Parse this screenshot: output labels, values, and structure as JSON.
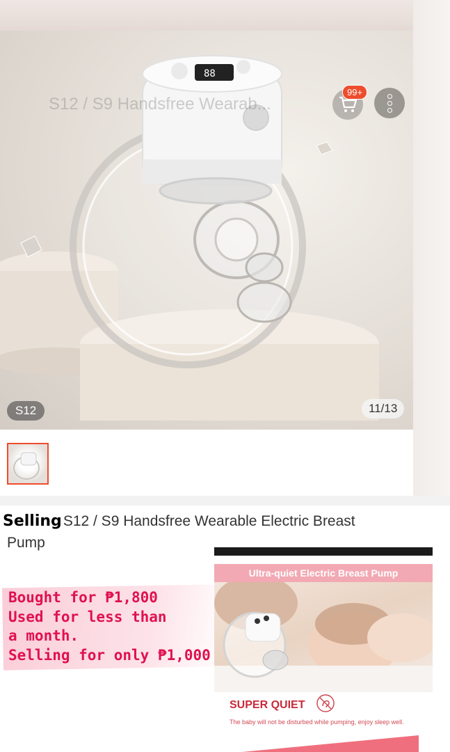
{
  "header": {
    "ghost_title": "S12 / S9 Handsfree Wearab...",
    "cart_badge": "99+",
    "cart_icon": "shopping-cart-icon",
    "more_icon": "more-vertical-icon"
  },
  "gallery": {
    "variant_label": "S12",
    "page_indicator": "11/13"
  },
  "listing": {
    "selling_label": "Selling",
    "title_part1": "S12 / S9 Handsfree Wearable Electric Breast",
    "title_part2": "Pump"
  },
  "note": {
    "line1": "Bought for ₱1,800",
    "line2": "Used for less than",
    "line3": "a month.",
    "line4": "Selling for only ₱1,000"
  },
  "ad": {
    "banner": "Ultra-quiet Electric Breast Pump",
    "heading": "SUPER QUIET",
    "subtext": "The baby will not be disturbed while pumping, enjoy sleep well."
  },
  "colors": {
    "accent": "#ee4d2d",
    "note_text": "#e0114f",
    "ad_banner": "#f2a9b3"
  }
}
